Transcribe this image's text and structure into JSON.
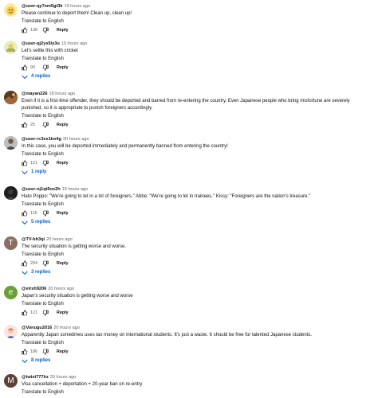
{
  "colors": {
    "link": "#065fd4",
    "meta": "#606060",
    "text": "#0f0f0f"
  },
  "comments": [
    {
      "author": "@user-qy7em5gt3k",
      "time": "19 hours ago",
      "text": "Please continue to deport them! Clean up, clean up!",
      "translate": "Translate to English",
      "likes": "138",
      "reply": "Reply",
      "replies": "",
      "avatar": {
        "kind": "image",
        "icon": "yellow-cartoon-avatar",
        "color": "#f2c94c"
      }
    },
    {
      "author": "@user-qj2ys5ly3u",
      "time": "19 hours ago",
      "text": "Let's settle this with cricket",
      "translate": "Translate to English",
      "likes": "99",
      "reply": "Reply",
      "replies": "4 replies",
      "avatar": {
        "kind": "image",
        "icon": "cartoon-avatar",
        "color": "#8bc34a"
      }
    },
    {
      "author": "@mayan226",
      "time": "18 hours ago",
      "text": "Even if it is a first-time offender, they should be deported and barred from re-entering the country. Even Japanese people who bring misfortune are severely punished, so it is appropriate to punish foreigners accordingly.",
      "translate": "Translate to English",
      "likes": "25",
      "reply": "Reply",
      "replies": "",
      "avatar": {
        "kind": "image",
        "icon": "photo-avatar",
        "color": "#7a4a2a"
      }
    },
    {
      "author": "@user-rc3es1ko4g",
      "time": "20 hours ago",
      "text": "In this case, you will be deported immediately and permanently banned from entering the country!",
      "translate": "Translate to English",
      "likes": "121",
      "reply": "Reply",
      "replies": "1 reply",
      "avatar": {
        "kind": "image",
        "icon": "photo-avatar",
        "color": "#9e9e9e"
      }
    },
    {
      "author": "@user-nj1qt5ox2h",
      "time": "19 hours ago",
      "text": "Hato Poppo: \"We're going to let in a lot of foreigners.\" Abbe: \"We're going to let in trainees.\" Kissy: \"Foreigners are the nation's treasure.\"",
      "translate": "Translate to English",
      "likes": "115",
      "reply": "Reply",
      "replies": "5 replies",
      "avatar": {
        "kind": "image",
        "icon": "photo-avatar",
        "color": "#2b2b2b"
      }
    },
    {
      "author": "@TV-bh3qi",
      "time": "20 hours ago",
      "text": "The security situation is getting worse and worse.",
      "translate": "Translate to English",
      "likes": "204",
      "reply": "Reply",
      "replies": "3 replies",
      "avatar": {
        "kind": "letter",
        "letter": "T",
        "color": "#8d6e63"
      }
    },
    {
      "author": "@eirsh9206",
      "time": "20 hours ago",
      "text": "Japan's security situation is getting worse and worse",
      "translate": "Translate to English",
      "likes": "121",
      "reply": "Reply",
      "replies": "",
      "avatar": {
        "kind": "letter",
        "letter": "e",
        "color": "#689f38"
      }
    },
    {
      "author": "@Vonugu2016",
      "time": "20 hours ago",
      "text": "Apparently Japan sometimes uses tax money on international students. It's just a waste. It should be free for talented Japanese students.",
      "translate": "Translate to English",
      "likes": "186",
      "reply": "Reply",
      "replies": "8 replies",
      "avatar": {
        "kind": "image",
        "icon": "cartoon-avatar",
        "color": "#e57373"
      }
    },
    {
      "author": "@twist777hz",
      "time": "20 hours ago",
      "text": "Visa cancellation + deportation + 20-year ban on re-entry",
      "translate": "Translate to English",
      "likes": "",
      "reply": "Reply",
      "replies": "",
      "avatar": {
        "kind": "letter",
        "letter": "M",
        "color": "#5d4037"
      }
    }
  ]
}
